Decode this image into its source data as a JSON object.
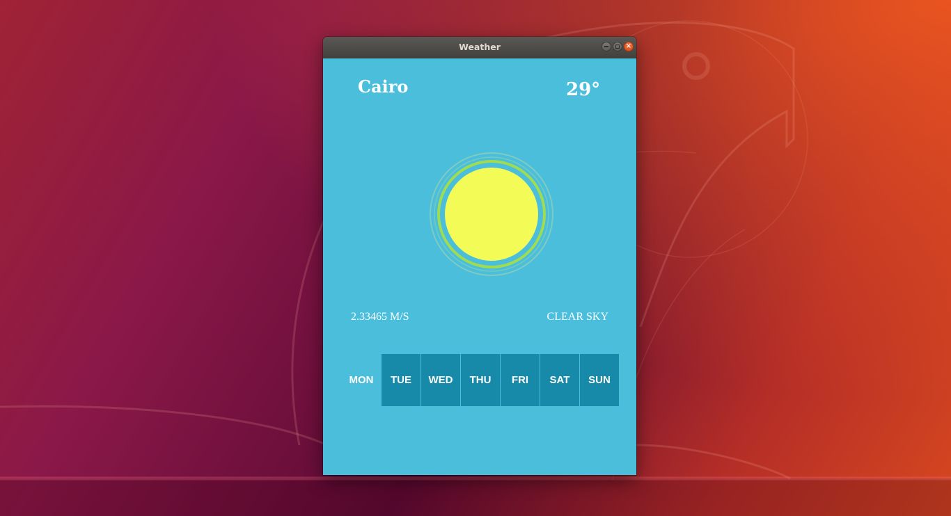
{
  "window": {
    "title": "Weather"
  },
  "weather": {
    "city": "Cairo",
    "temperature": "29°",
    "wind_speed": "2.33465 M/S",
    "condition": "CLEAR SKY",
    "icon": "sun-icon"
  },
  "days": [
    {
      "label": "MON",
      "selected": true
    },
    {
      "label": "TUE",
      "selected": false
    },
    {
      "label": "WED",
      "selected": false
    },
    {
      "label": "THU",
      "selected": false
    },
    {
      "label": "FRI",
      "selected": false
    },
    {
      "label": "SAT",
      "selected": false
    },
    {
      "label": "SUN",
      "selected": false
    }
  ],
  "colors": {
    "background": "#4bbedc",
    "day_tile": "#168aa8",
    "sun": "#f3fb57",
    "sun_ring": "#9fdc52",
    "close_button": "#e95420"
  }
}
